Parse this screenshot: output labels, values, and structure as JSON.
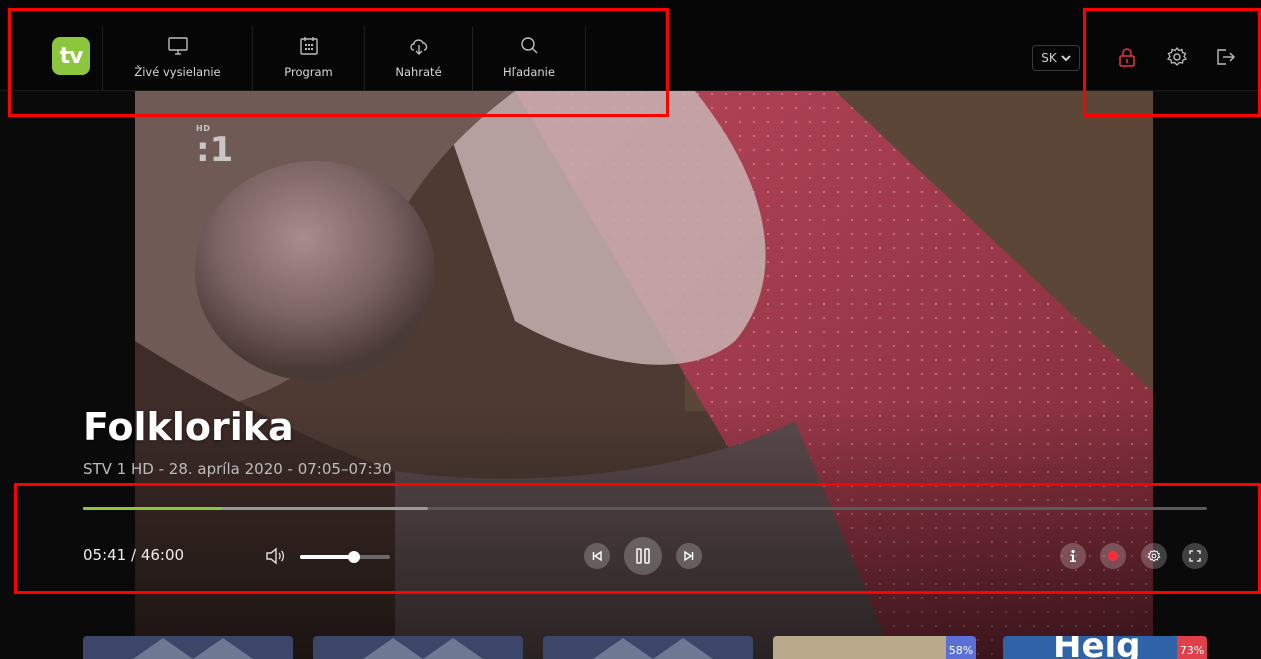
{
  "app": {
    "logo_text": "tv",
    "accent_color": "#8cc63f"
  },
  "nav": {
    "items": [
      {
        "label": "Živé vysielanie",
        "icon": "monitor-icon"
      },
      {
        "label": "Program",
        "icon": "calendar-icon"
      },
      {
        "label": "Nahraté",
        "icon": "cloud-download-icon"
      },
      {
        "label": "Hľadanie",
        "icon": "search-icon"
      }
    ]
  },
  "header": {
    "language": "SK",
    "icons": [
      "lock-icon",
      "gear-icon",
      "logout-icon"
    ],
    "lock_color": "#e8323c"
  },
  "player": {
    "channel_logo": ":1",
    "channel_hd": "HD",
    "title": "Folklorika",
    "subtitle": "STV 1 HD - 28. apríla 2020 - 07:05–07:30",
    "time": "05:41 / 46:00",
    "progress_fraction": 0.124,
    "buffer_fraction": 0.307,
    "volume_fraction": 0.6,
    "controls": [
      "prev-icon",
      "pause-icon",
      "next-icon",
      "info-icon",
      "record-icon",
      "settings-icon",
      "fullscreen-icon"
    ],
    "record_color": "#ff2b3a"
  },
  "thumbnails": [
    {
      "badge": ""
    },
    {
      "badge": ""
    },
    {
      "badge": ""
    },
    {
      "badge": "58%",
      "badge_color": "#5b6fd6"
    },
    {
      "badge": "73%",
      "badge_color": "#e0404a",
      "title": "Helg"
    }
  ]
}
